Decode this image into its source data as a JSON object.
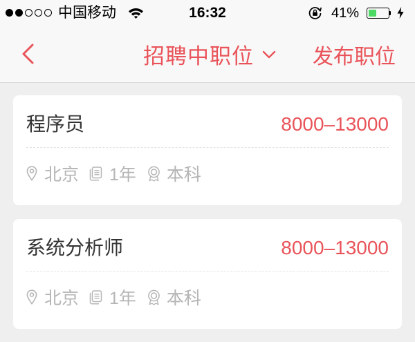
{
  "status_bar": {
    "signal_strength": 2,
    "signal_max": 5,
    "carrier": "中国移动",
    "time": "16:32",
    "battery_text": "41%",
    "battery_level": 0.41,
    "icons": [
      "wifi-icon",
      "rotation-lock-icon",
      "battery-icon",
      "charging-bolt-icon"
    ]
  },
  "nav": {
    "back_icon": "chevron-left-icon",
    "title": "招聘中职位",
    "title_dropdown_icon": "chevron-down-icon",
    "publish_label": "发布职位"
  },
  "meta_icons": {
    "location": "location-pin-icon",
    "experience": "document-icon",
    "education": "medal-icon"
  },
  "jobs": [
    {
      "title": "程序员",
      "salary": "8000–13000",
      "location": "北京",
      "experience": "1年",
      "education": "本科"
    },
    {
      "title": "系统分析师",
      "salary": "8000–13000",
      "location": "北京",
      "experience": "1年",
      "education": "本科"
    }
  ],
  "colors": {
    "accent": "#e9545a",
    "title_text": "#333333",
    "meta_text": "#b5b5b5",
    "battery_fill": "#4cd964",
    "page_background": "#efefef",
    "nav_background": "#f8f8f8",
    "card_background": "#ffffff"
  }
}
